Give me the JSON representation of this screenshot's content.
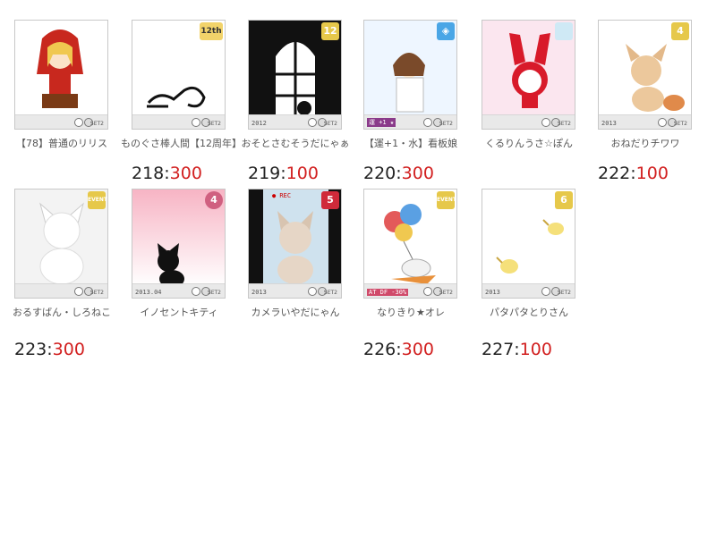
{
  "items": [
    {
      "caption": "【78】普通のリリス",
      "id": "",
      "value": "",
      "badge": "",
      "year": ""
    },
    {
      "caption": "ものぐさ棒人間【12周年】",
      "id": "218",
      "value": "300",
      "badge": "12th",
      "year": ""
    },
    {
      "caption": "おそとさむそうだにゃぁ",
      "id": "219",
      "value": "100",
      "badge": "12",
      "year": "2012"
    },
    {
      "caption": "【運+1・水】看板娘",
      "id": "220",
      "value": "300",
      "badge": "",
      "year": ""
    },
    {
      "caption": "くるりんうさ☆ぽん",
      "id": "",
      "value": "",
      "badge": "",
      "year": ""
    },
    {
      "caption": "おねだりチワワ",
      "id": "222",
      "value": "100",
      "badge": "4",
      "year": "2013"
    },
    {
      "caption": "おるすばん・しろねこ",
      "id": "223",
      "value": "300",
      "badge": "EVENT",
      "year": ""
    },
    {
      "caption": "イノセントキティ",
      "id": "",
      "value": "",
      "badge": "4",
      "year": "2013.04"
    },
    {
      "caption": "カメラいやだにゃん",
      "id": "",
      "value": "",
      "badge": "5",
      "year": "2013"
    },
    {
      "caption": "なりきり★オレ",
      "id": "226",
      "value": "300",
      "badge": "EVENT",
      "year": ""
    },
    {
      "caption": "パタパタとりさん",
      "id": "227",
      "value": "100",
      "badge": "6",
      "year": "2013"
    }
  ],
  "thumb_labels": {
    "set": "SET2",
    "rec": "● REC",
    "stat1": "運 +1 ★",
    "stat2": "AT DF -30%"
  }
}
